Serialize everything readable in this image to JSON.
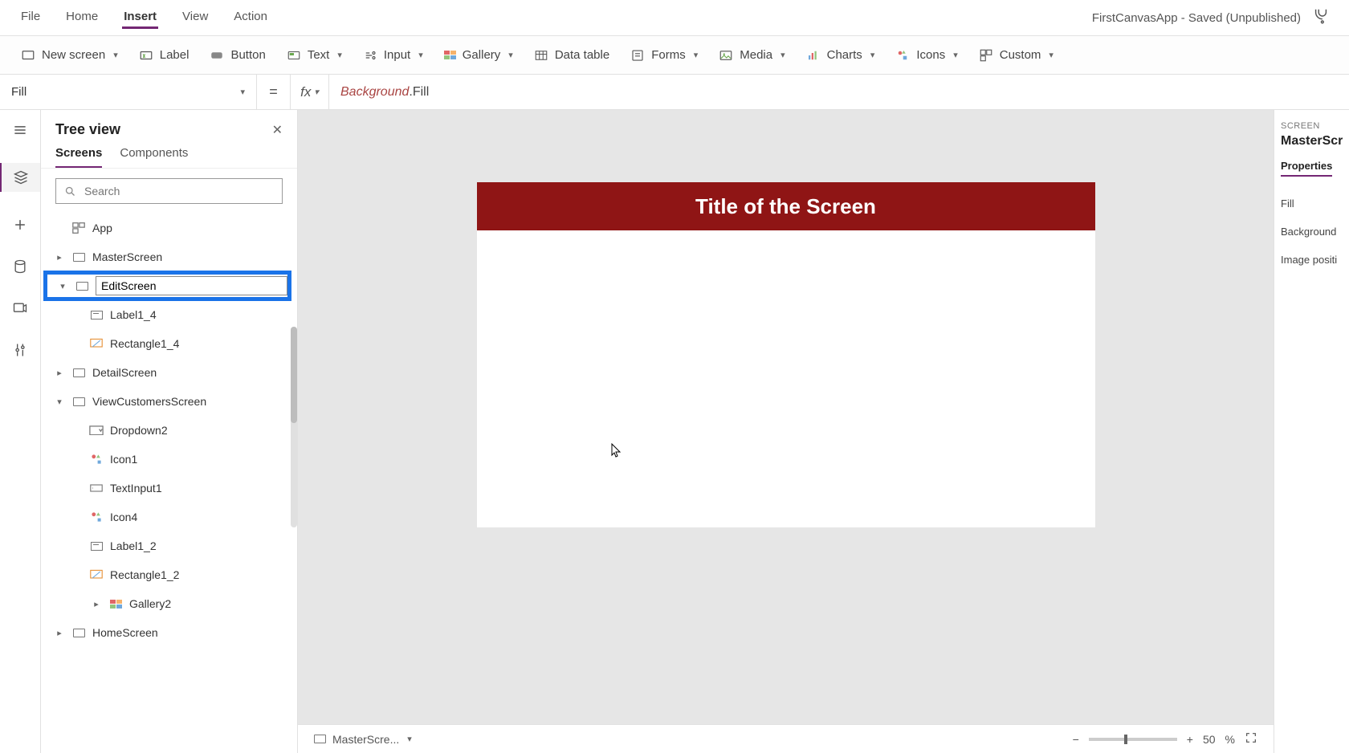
{
  "app_title": "FirstCanvasApp - Saved (Unpublished)",
  "menu": {
    "file": "File",
    "home": "Home",
    "insert": "Insert",
    "view": "View",
    "action": "Action"
  },
  "ribbon": {
    "new_screen": "New screen",
    "label": "Label",
    "button": "Button",
    "text": "Text",
    "input": "Input",
    "gallery": "Gallery",
    "data_table": "Data table",
    "forms": "Forms",
    "media": "Media",
    "charts": "Charts",
    "icons": "Icons",
    "custom": "Custom"
  },
  "formula": {
    "property": "Fill",
    "eq": "=",
    "fx": "fx",
    "token1": "Background",
    "token2": ".Fill"
  },
  "treeview": {
    "title": "Tree view",
    "tabs": {
      "screens": "Screens",
      "components": "Components"
    },
    "search_placeholder": "Search",
    "items": {
      "app": "App",
      "master": "MasterScreen",
      "edit_value": "EditScreen",
      "label14": "Label1_4",
      "rect14": "Rectangle1_4",
      "detail": "DetailScreen",
      "viewcust": "ViewCustomersScreen",
      "dropdown2": "Dropdown2",
      "icon1": "Icon1",
      "textinput1": "TextInput1",
      "icon4": "Icon4",
      "label12": "Label1_2",
      "rect12": "Rectangle1_2",
      "gallery2": "Gallery2",
      "home": "HomeScreen"
    }
  },
  "canvas": {
    "header_text": "Title of the Screen",
    "bottom_screen_label": "MasterScre...",
    "zoom_value": "50",
    "zoom_pct": "%"
  },
  "properties": {
    "panel_label": "SCREEN",
    "name": "MasterScre",
    "tab": "Properties",
    "rows": {
      "fill": "Fill",
      "bgimg": "Background",
      "imgpos": "Image positi"
    }
  }
}
